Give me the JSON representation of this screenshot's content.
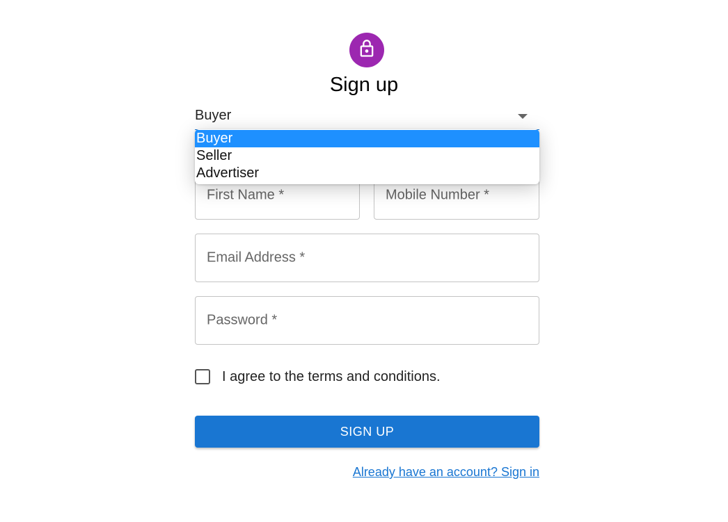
{
  "header": {
    "title": "Sign up",
    "icon": "lock-icon",
    "avatar_color": "#9c27b0"
  },
  "role_select": {
    "value": "Buyer",
    "options": [
      "Buyer",
      "Seller",
      "Advertiser"
    ],
    "selected_index": 0
  },
  "fields": {
    "first_name": "First Name *",
    "mobile": "Mobile Number *",
    "email": "Email Address *",
    "password": "Password *"
  },
  "terms": {
    "label": "I agree to the terms and conditions.",
    "checked": false
  },
  "submit": {
    "label": "SIGN UP",
    "color": "#1976d2"
  },
  "signin_link": "Already have an account? Sign in",
  "colors": {
    "accent": "#1976d2",
    "option_highlight": "#1e90ff"
  }
}
